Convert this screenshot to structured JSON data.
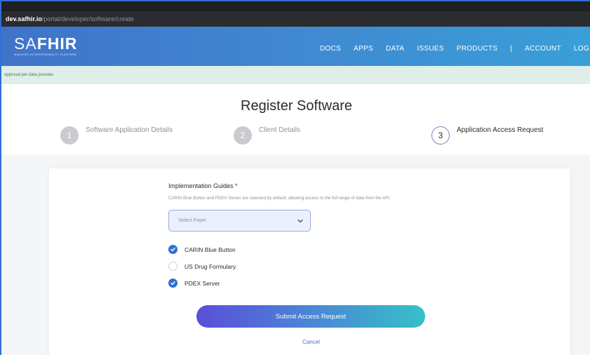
{
  "browser": {
    "url_host": "dev.safhir.io",
    "url_path": "/portal/developer/software/create"
  },
  "header": {
    "logo_light": "SA",
    "logo_bold": "FHIR",
    "logo_tagline": "MANAGED INTEROPERABILITY PLATFORM",
    "nav": [
      {
        "label": "DOCS"
      },
      {
        "label": "APPS"
      },
      {
        "label": "DATA"
      },
      {
        "label": "ISSUES"
      },
      {
        "label": "PRODUCTS"
      },
      {
        "label": "|"
      },
      {
        "label": "ACCOUNT"
      },
      {
        "label": "LOG"
      }
    ]
  },
  "notice": {
    "text": "approval per data provider."
  },
  "page": {
    "title": "Register Software"
  },
  "stepper": {
    "steps": [
      {
        "number": "1",
        "label": "Software Application Details",
        "state": "done"
      },
      {
        "number": "2",
        "label": "Client Details",
        "state": "done"
      },
      {
        "number": "3",
        "label": "Application Access Request",
        "state": "active"
      }
    ]
  },
  "form": {
    "label": "Implementation Guides *",
    "help": "CARIN Blue Button and PDEX Server are selected by default, allowing access to the full range of data from the API.",
    "select_placeholder": "Select Payer",
    "options": [
      {
        "label": "CARIN Blue Button",
        "checked": true
      },
      {
        "label": "US Drug Formulary",
        "checked": false
      },
      {
        "label": "PDEX Server",
        "checked": true
      }
    ],
    "submit_label": "Submit Access Request",
    "cancel_label": "Cancel"
  },
  "colors": {
    "nav_start": "#3f73c9",
    "nav_end": "#3a9fd8",
    "checkbox_on": "#2d6fd6",
    "button_start": "#5a4fd8",
    "button_end": "#36c0c8",
    "link": "#4b6fd0"
  }
}
